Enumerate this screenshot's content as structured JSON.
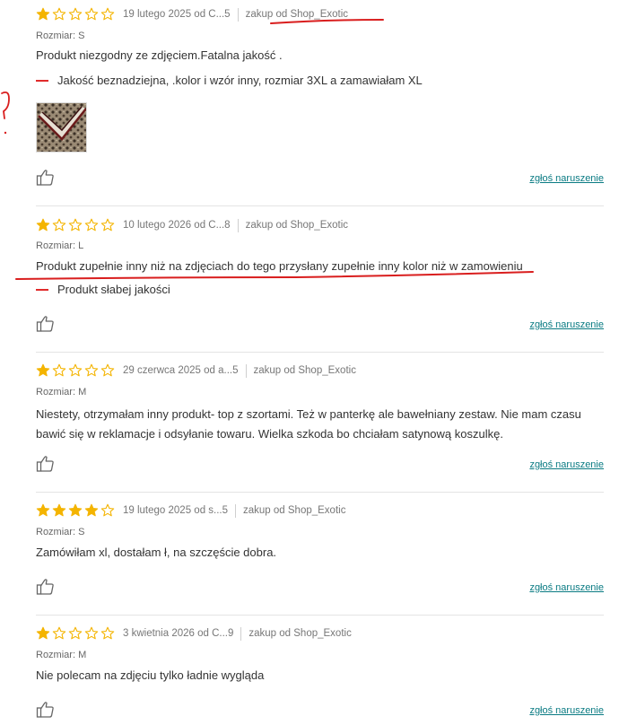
{
  "colors": {
    "star_filled": "#f4b400",
    "star_outline": "#f4b400",
    "report_link": "#0a7b83",
    "cons_dash": "#e02b2b",
    "annotation": "#d91e1e"
  },
  "icons": {
    "thumb": "thumbs-up-icon",
    "star": "star-icon"
  },
  "reviews": [
    {
      "rating": 1,
      "date": "19 lutego 2025 od C...5",
      "purchase": "zakup od Shop_Exotic",
      "size_label": "Rozmiar:",
      "size": "S",
      "text": "Produkt niezgodny ze zdjęciem.Fatalna jakość .",
      "cons": "Jakość beznadziejna, .kolor i wzór inny, rozmiar 3XL a zamawiałam XL",
      "report": "zgłoś naruszenie"
    },
    {
      "rating": 1,
      "date": "10 lutego 2026 od C...8",
      "purchase": "zakup od Shop_Exotic",
      "size_label": "Rozmiar:",
      "size": "L",
      "text": "Produkt zupełnie inny niż na zdjęciach do tego przysłany zupełnie inny kolor niż w zamowieniu",
      "cons": "Produkt słabej jakości",
      "report": "zgłoś naruszenie"
    },
    {
      "rating": 1,
      "date": "29 czerwca 2025 od a...5",
      "purchase": "zakup od Shop_Exotic",
      "size_label": "Rozmiar:",
      "size": "M",
      "text": "Niestety, otrzymałam inny produkt- top z szortami. Też w panterkę ale bawełniany zestaw. Nie mam czasu bawić się w reklamacje i odsyłanie towaru. Wielka szkoda bo chciałam satynową koszulkę.",
      "report": "zgłoś naruszenie"
    },
    {
      "rating": 4,
      "date": "19 lutego 2025 od s...5",
      "purchase": "zakup od Shop_Exotic",
      "size_label": "Rozmiar:",
      "size": "S",
      "text": "Zamówiłam xl, dostałam ł, na szczęście dobra.",
      "report": "zgłoś naruszenie"
    },
    {
      "rating": 1,
      "date": "3 kwietnia 2026 od C...9",
      "purchase": "zakup od Shop_Exotic",
      "size_label": "Rozmiar:",
      "size": "M",
      "text": "Nie polecam na zdjęciu tylko ładnie wygląda",
      "report": "zgłoś naruszenie"
    }
  ]
}
